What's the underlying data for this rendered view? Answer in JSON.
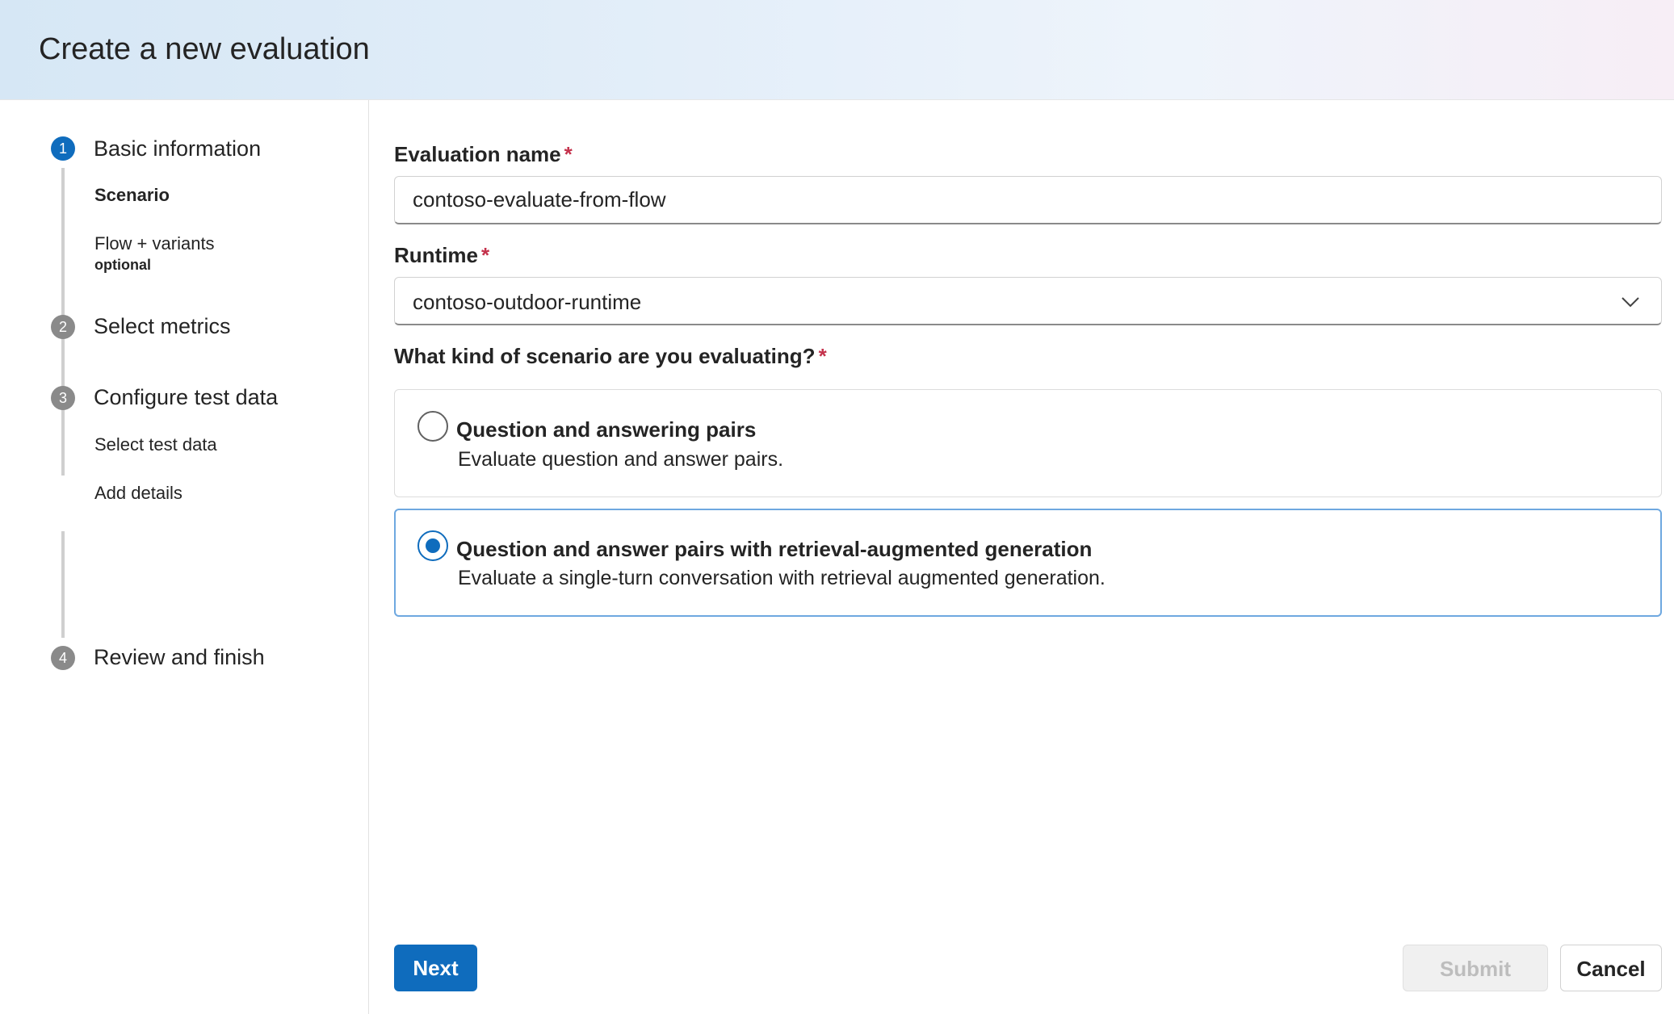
{
  "header": {
    "title": "Create a new evaluation"
  },
  "steps": [
    {
      "number": "1",
      "label": "Basic information",
      "active": true,
      "substeps": [
        {
          "label": "Scenario",
          "active": true
        },
        {
          "label": "Flow + variants",
          "note": "optional"
        }
      ]
    },
    {
      "number": "2",
      "label": "Select metrics"
    },
    {
      "number": "3",
      "label": "Configure test data",
      "substeps": [
        {
          "label": "Select test data"
        },
        {
          "label": "Add details"
        }
      ]
    },
    {
      "number": "4",
      "label": "Review and finish"
    }
  ],
  "form": {
    "required_marker": "*",
    "evaluation_name": {
      "label": "Evaluation name",
      "value": "contoso-evaluate-from-flow"
    },
    "runtime": {
      "label": "Runtime",
      "value": "contoso-outdoor-runtime"
    },
    "scenario_question": "What kind of scenario are you evaluating?",
    "options": [
      {
        "title": "Question and answering pairs",
        "description": "Evaluate question and answer pairs.",
        "selected": false
      },
      {
        "title": "Question and answer pairs with retrieval-augmented generation",
        "description": "Evaluate a single-turn conversation with retrieval augmented generation.",
        "selected": true
      }
    ]
  },
  "footer": {
    "next_label": "Next",
    "submit_label": "Submit",
    "cancel_label": "Cancel"
  },
  "colors": {
    "accent": "#0f6cbd",
    "required": "#c4314b",
    "inactive_step": "#8a8a8a"
  }
}
